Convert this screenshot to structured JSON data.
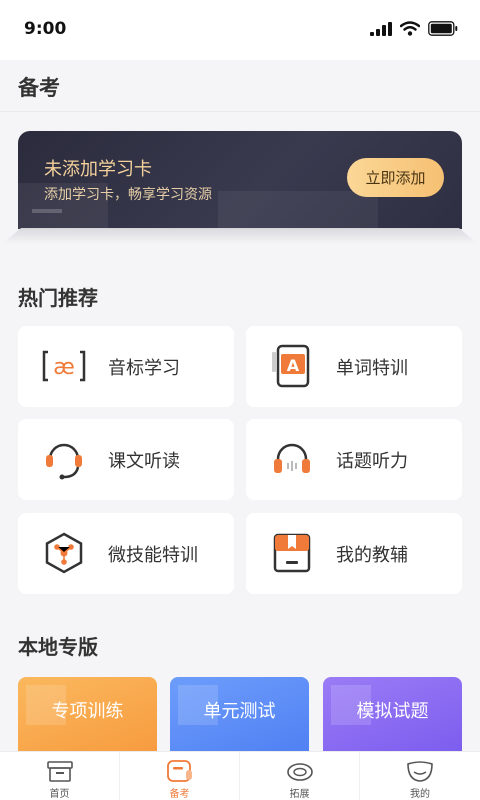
{
  "status_bar": {
    "time": "9:00"
  },
  "header": {
    "title": "备考"
  },
  "banner": {
    "title": "未添加学习卡",
    "subtitle": "添加学习卡，畅享学习资源",
    "button_label": "立即添加"
  },
  "hot": {
    "title": "热门推荐",
    "items": [
      {
        "label": "音标学习",
        "icon": "phonetic-icon"
      },
      {
        "label": "单词特训",
        "icon": "word-card-icon"
      },
      {
        "label": "课文听读",
        "icon": "headset-mic-icon"
      },
      {
        "label": "话题听力",
        "icon": "headphones-icon"
      },
      {
        "label": "微技能特训",
        "icon": "hexagon-skill-icon"
      },
      {
        "label": "我的教辅",
        "icon": "book-icon"
      }
    ]
  },
  "local": {
    "title": "本地专版",
    "cards": [
      {
        "label": "专项训练",
        "color": "#f9a64b"
      },
      {
        "label": "单元测试",
        "color": "#5b8cf7"
      },
      {
        "label": "模拟试题",
        "color": "#8a6cf2"
      }
    ]
  },
  "tabs": [
    {
      "label": "首页",
      "icon": "home-box-icon",
      "active": false
    },
    {
      "label": "备考",
      "icon": "study-icon",
      "active": true
    },
    {
      "label": "拓展",
      "icon": "expand-icon",
      "active": false
    },
    {
      "label": "我的",
      "icon": "profile-icon",
      "active": false
    }
  ],
  "colors": {
    "accent": "#f07a3a",
    "banner_text": "#f4d19b",
    "button": "#f8c97f"
  }
}
